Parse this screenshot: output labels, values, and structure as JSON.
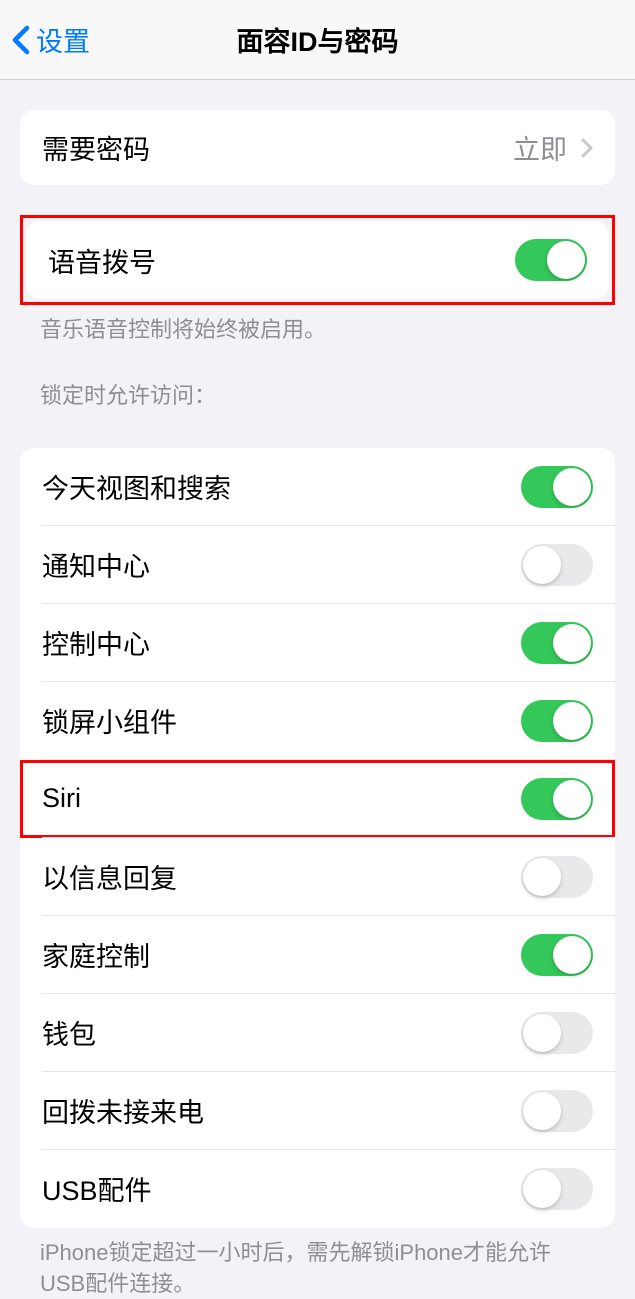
{
  "header": {
    "back_label": "设置",
    "title": "面容ID与密码"
  },
  "require_passcode": {
    "label": "需要密码",
    "value": "立即"
  },
  "voice_dial": {
    "label": "语音拨号",
    "enabled": true,
    "footer": "音乐语音控制将始终被启用。"
  },
  "lock_access": {
    "header": "锁定时允许访问：",
    "items": [
      {
        "label": "今天视图和搜索",
        "enabled": true
      },
      {
        "label": "通知中心",
        "enabled": false
      },
      {
        "label": "控制中心",
        "enabled": true
      },
      {
        "label": "锁屏小组件",
        "enabled": true
      },
      {
        "label": "Siri",
        "enabled": true
      },
      {
        "label": "以信息回复",
        "enabled": false
      },
      {
        "label": "家庭控制",
        "enabled": true
      },
      {
        "label": "钱包",
        "enabled": false
      },
      {
        "label": "回拨未接来电",
        "enabled": false
      },
      {
        "label": "USB配件",
        "enabled": false
      }
    ],
    "footer": "iPhone锁定超过一小时后，需先解锁iPhone才能允许USB配件连接。"
  },
  "highlighted_rows": [
    0,
    5
  ]
}
